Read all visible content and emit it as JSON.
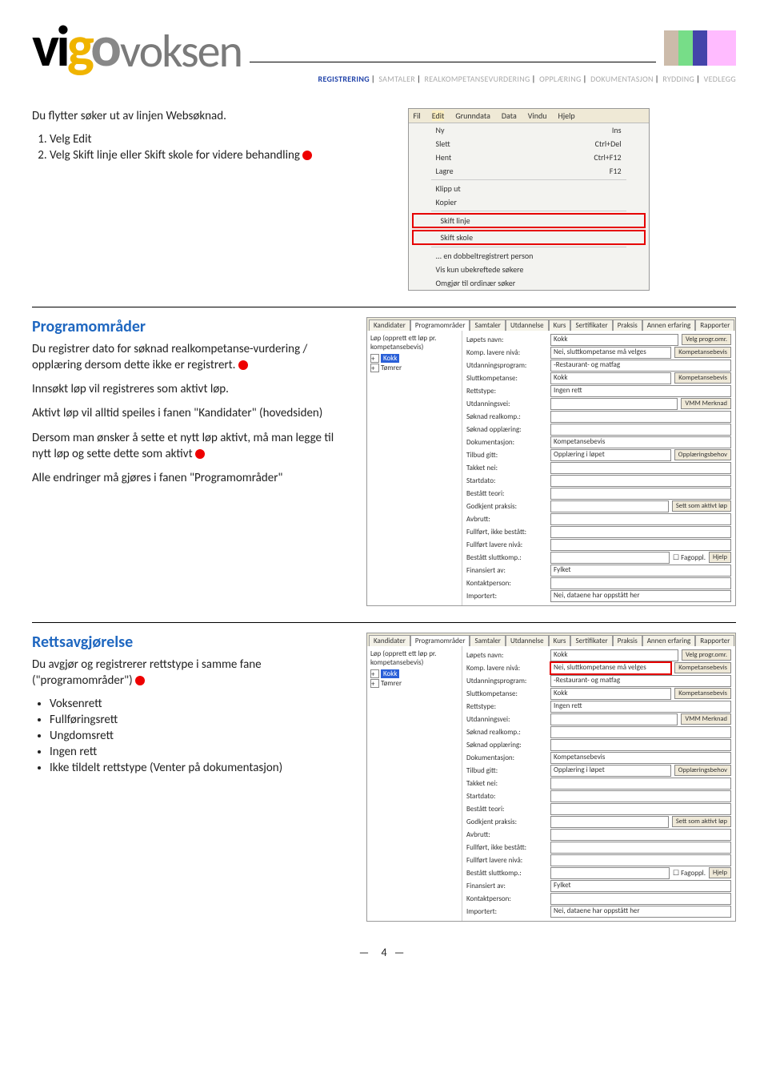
{
  "header": {
    "logo_v": "v",
    "logo_i": "i",
    "logo_g": "g",
    "logo_o": "o",
    "voksen": "voksen",
    "breadcrumb": [
      "REGISTRERING",
      "SAMTALER",
      "REALKOMPETANSEVURDERING",
      "OPPLÆRING",
      "DOKUMENTASJON",
      "RYDDING",
      "VEDLEGG"
    ],
    "breadcrumb_active": 0
  },
  "sec1": {
    "p1": "Du flytter søker ut av linjen Websøknad.",
    "li1": "Velg Edit",
    "li2": "Velg Skift linje eller Skift skole for videre behandling"
  },
  "menu": {
    "bar": [
      "Fil",
      "Edit",
      "Grunndata",
      "Data",
      "Vindu",
      "Hjelp"
    ],
    "rows": [
      {
        "l": "Ny",
        "r": "Ins"
      },
      {
        "l": "Slett",
        "r": "Ctrl+Del"
      },
      {
        "l": "Hent",
        "r": "Ctrl+F12"
      },
      {
        "l": "Lagre",
        "r": "F12"
      }
    ],
    "plain": [
      "Klipp ut",
      "Kopier"
    ],
    "hl": [
      "Skift linje",
      "Skift skole"
    ],
    "tail": [
      "... en dobbeltregistrert person",
      "Vis kun ubekreftede søkere",
      "Omgjør til ordinær søker"
    ]
  },
  "sec2": {
    "title": "Programområder",
    "p1": "Du registrer dato for søknad realkompetanse-vurdering / opplæring dersom dette ikke er registrert.",
    "p2": "Innsøkt løp vil registreres som aktivt løp.",
    "p3": "Aktivt løp vil alltid speiles i fanen \"Kandidater\" (hovedsiden)",
    "p4": "Dersom man ønsker å sette et nytt løp aktivt, må man legge til nytt løp og sette dette som aktivt",
    "p5": "Alle endringer må gjøres i fanen \"Programområder\""
  },
  "form": {
    "tabs": [
      "Kandidater",
      "Programområder",
      "Samtaler",
      "Utdannelse",
      "Kurs",
      "Sertifikater",
      "Praksis",
      "Annen erfaring",
      "Rapporter"
    ],
    "left_top": "Løp (opprett ett løp pr. kompetansebevis)",
    "left_items": [
      "Kokk",
      "Tømrer"
    ],
    "fields": [
      {
        "l": "Løpets navn:",
        "v": "Kokk"
      },
      {
        "l": "Komp. lavere nivå:",
        "v": "Nei, sluttkompetanse må velges"
      },
      {
        "l": "Utdanningsprogram:",
        "v": "-Restaurant- og matfag"
      },
      {
        "l": "Sluttkompetanse:",
        "v": "Kokk"
      },
      {
        "l": "Rettstype:",
        "v": "Ingen rett"
      },
      {
        "l": "Utdanningsvei:",
        "v": ""
      },
      {
        "l": "Søknad realkomp.:",
        "v": ""
      },
      {
        "l": "Søknad opplæring:",
        "v": ""
      },
      {
        "l": "Dokumentasjon:",
        "v": "Kompetansebevis"
      },
      {
        "l": "Tilbud gitt:",
        "v": "Opplæring i løpet"
      },
      {
        "l": "Takket nei:",
        "v": ""
      },
      {
        "l": "Startdato:",
        "v": ""
      },
      {
        "l": "Bestått teori:",
        "v": ""
      },
      {
        "l": "Godkjent praksis:",
        "v": ""
      },
      {
        "l": "Avbrutt:",
        "v": ""
      },
      {
        "l": "Fullført, ikke bestått:",
        "v": ""
      },
      {
        "l": "Fullført lavere nivå:",
        "v": ""
      },
      {
        "l": "Bestått sluttkomp.:",
        "v": ""
      },
      {
        "l": "Finansiert av:",
        "v": "Fylket"
      },
      {
        "l": "Kontaktperson:",
        "v": ""
      },
      {
        "l": "Importert:",
        "v": "Nei, dataene har oppstått her"
      }
    ],
    "side_btns": [
      "Velg progr.omr.",
      "Kompetansebevis",
      "VMM Merknad",
      "Opplæringsbehov",
      "Sett som aktivt løp",
      "Hjelp"
    ],
    "fagoppl": "Fagoppl."
  },
  "sec3": {
    "title": "Rettsavgjørelse",
    "p1": "Du avgjør og registrerer rettstype i samme fane (\"programområder\")",
    "items": [
      "Voksenrett",
      "Fullføringsrett",
      "Ungdomsrett",
      "Ingen rett",
      "Ikke tildelt rettstype (Venter på dokumentasjon)"
    ]
  },
  "pagenum": "4"
}
